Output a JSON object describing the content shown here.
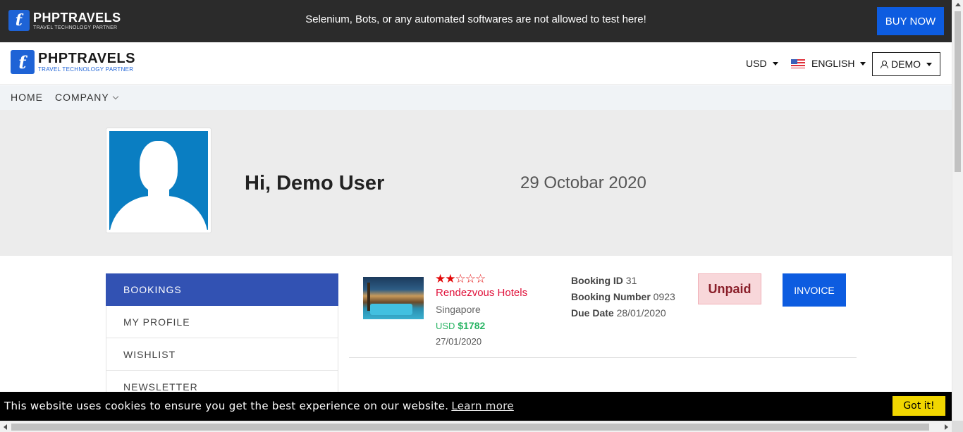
{
  "topbar": {
    "logo_name": "PHPTRAVELS",
    "logo_tagline": "TRAVEL TECHNOLOGY PARTNER",
    "message": "Selenium, Bots, or any automated softwares are not allowed to test here!",
    "buy_now_label": "BUY NOW"
  },
  "header": {
    "logo_name": "PHPTRAVELS",
    "logo_tagline": "TRAVEL TECHNOLOGY PARTNER",
    "currency": "USD",
    "language": "ENGLISH",
    "account_label": "DEMO"
  },
  "nav": {
    "home": "HOME",
    "company": "COMPANY"
  },
  "profile": {
    "greeting": "Hi, Demo User",
    "date": "29 Octobar 2020"
  },
  "sidebar": {
    "items": [
      {
        "label": "BOOKINGS"
      },
      {
        "label": "MY PROFILE"
      },
      {
        "label": "WISHLIST"
      },
      {
        "label": "NEWSLETTER"
      }
    ]
  },
  "booking": {
    "stars_filled": 2,
    "stars_total": 5,
    "hotel_name": "Rendezvous Hotels",
    "city": "Singapore",
    "price_currency": "USD",
    "price": "$1782",
    "date": "27/01/2020",
    "booking_id_label": "Booking ID",
    "booking_id": "31",
    "booking_number_label": "Booking Number",
    "booking_number": "0923",
    "due_date_label": "Due Date",
    "due_date": "28/01/2020",
    "status": "Unpaid",
    "invoice_label": "INVOICE"
  },
  "cookie": {
    "message": "This website uses cookies to ensure you get the best experience on our website.",
    "learn_more": "Learn more",
    "accept_label": "Got it!"
  },
  "colors": {
    "primary": "#0d5ce0",
    "sidebar_active": "#3252b3",
    "hotel_name": "#e0113a",
    "price": "#28b463",
    "unpaid_bg": "#f8d7da",
    "cookie_button": "#f1d600"
  }
}
